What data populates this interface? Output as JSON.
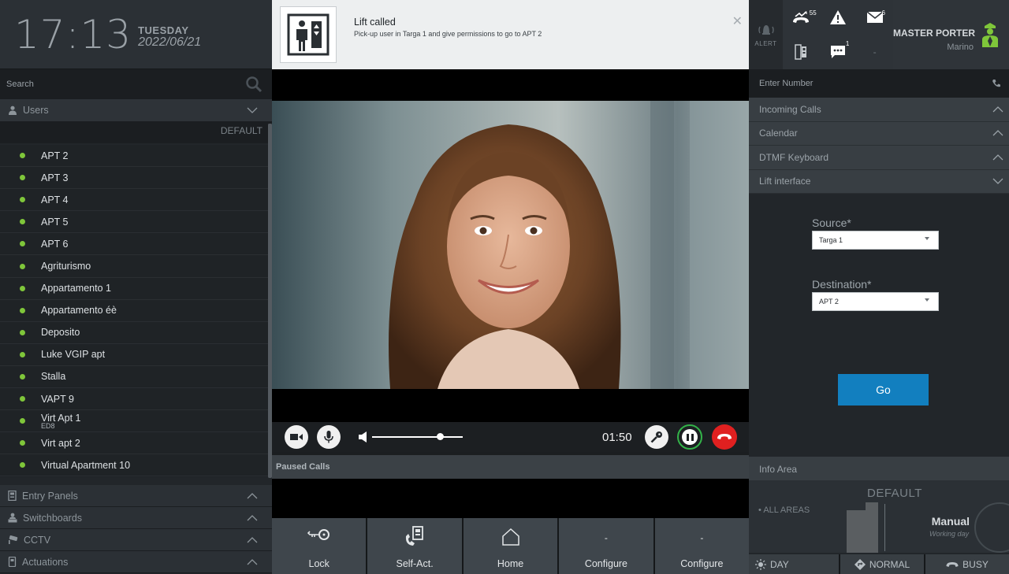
{
  "clock": {
    "time": "17:13",
    "day": "TUESDAY",
    "date": "2022/06/21"
  },
  "left": {
    "search_placeholder": "Search",
    "users_label": "Users",
    "default_label": "DEFAULT",
    "users": [
      {
        "name": "APT 2",
        "sub": ""
      },
      {
        "name": "APT 3",
        "sub": ""
      },
      {
        "name": "APT 4",
        "sub": ""
      },
      {
        "name": "APT 5",
        "sub": ""
      },
      {
        "name": "APT 6",
        "sub": ""
      },
      {
        "name": "Agriturismo",
        "sub": ""
      },
      {
        "name": "Appartamento 1",
        "sub": ""
      },
      {
        "name": "Appartamento éè",
        "sub": ""
      },
      {
        "name": "Deposito",
        "sub": ""
      },
      {
        "name": "Luke VGIP apt",
        "sub": ""
      },
      {
        "name": "Stalla",
        "sub": ""
      },
      {
        "name": "VAPT 9",
        "sub": ""
      },
      {
        "name": "Virt Apt 1",
        "sub": "ED8"
      },
      {
        "name": "Virt apt 2",
        "sub": ""
      },
      {
        "name": "Virtual Apartment 10",
        "sub": ""
      }
    ],
    "sections": [
      "Entry Panels",
      "Switchboards",
      "CCTV",
      "Actuations"
    ]
  },
  "notification": {
    "title": "Lift called",
    "text": "Pick-up user in Targa 1 and give permissions to go to APT 2"
  },
  "call": {
    "timer": "01:50",
    "volume_level": 0.75
  },
  "paused_calls_label": "Paused Calls",
  "actions": [
    {
      "label": "Lock",
      "icon": "key-lock-icon"
    },
    {
      "label": "Self-Act.",
      "icon": "self-actuation-icon"
    },
    {
      "label": "Home",
      "icon": "home-icon"
    },
    {
      "label": "Configure",
      "icon": "-"
    },
    {
      "label": "Configure",
      "icon": "-"
    }
  ],
  "top_right": {
    "alert_label": "ALERT",
    "missed_calls_count": "55",
    "messages_count": "6",
    "chat_count": "1",
    "empty_cell": "-",
    "role": "MASTER PORTER",
    "user": "Marino"
  },
  "right": {
    "number_placeholder": "Enter Number",
    "accordions": [
      "Incoming Calls",
      "Calendar",
      "DTMF Keyboard",
      "Lift interface"
    ],
    "lift": {
      "source_label": "Source*",
      "source_value": "Targa 1",
      "destination_label": "Destination*",
      "destination_value": "APT 2",
      "go_label": "Go"
    },
    "info_area": {
      "title": "Info Area",
      "default": "DEFAULT",
      "areas": "ALL AREAS",
      "mode": "Manual",
      "mode_sub": "Working day"
    },
    "modes": [
      "DAY",
      "NORMAL",
      "BUSY"
    ]
  },
  "colors": {
    "online": "#7fc63a",
    "accent": "#127fbf",
    "hangup": "#e02020",
    "hold": "#33b249"
  }
}
